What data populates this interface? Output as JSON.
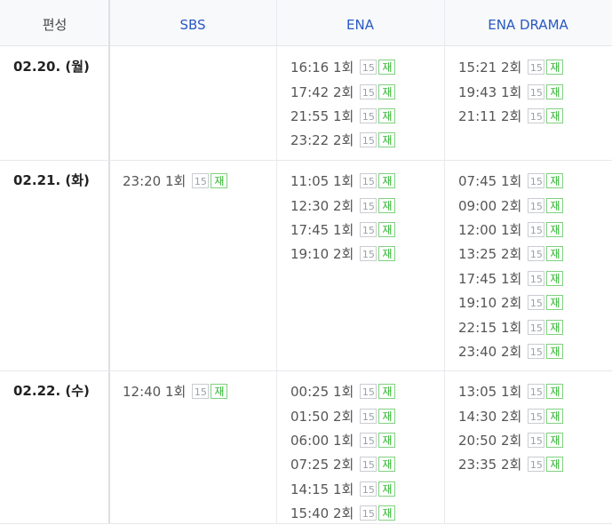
{
  "header": {
    "first": "편성",
    "channels": [
      "SBS",
      "ENA",
      "ENA DRAMA"
    ]
  },
  "badges": {
    "rating": "15",
    "rerun": "재"
  },
  "days": [
    {
      "date": "02.20. (월)",
      "SBS": [],
      "ENA": [
        "16:16 1회",
        "17:42 2회",
        "21:55 1회",
        "23:22 2회"
      ],
      "ENA_DRAMA": [
        "15:21 2회",
        "19:43 1회",
        "21:11 2회"
      ]
    },
    {
      "date": "02.21. (화)",
      "SBS": [
        "23:20 1회"
      ],
      "ENA": [
        "11:05 1회",
        "12:30 2회",
        "17:45 1회",
        "19:10 2회"
      ],
      "ENA_DRAMA": [
        "07:45 1회",
        "09:00 2회",
        "12:00 1회",
        "13:25 2회",
        "17:45 1회",
        "19:10 2회",
        "22:15 1회",
        "23:40 2회"
      ]
    },
    {
      "date": "02.22. (수)",
      "SBS": [
        "12:40 1회"
      ],
      "ENA": [
        "00:25 1회",
        "01:50 2회",
        "06:00 1회",
        "07:25 2회",
        "14:15 1회",
        "15:40 2회"
      ],
      "ENA_DRAMA": [
        "13:05 1회",
        "14:30 2회",
        "20:50 2회",
        "23:35 2회"
      ]
    }
  ]
}
